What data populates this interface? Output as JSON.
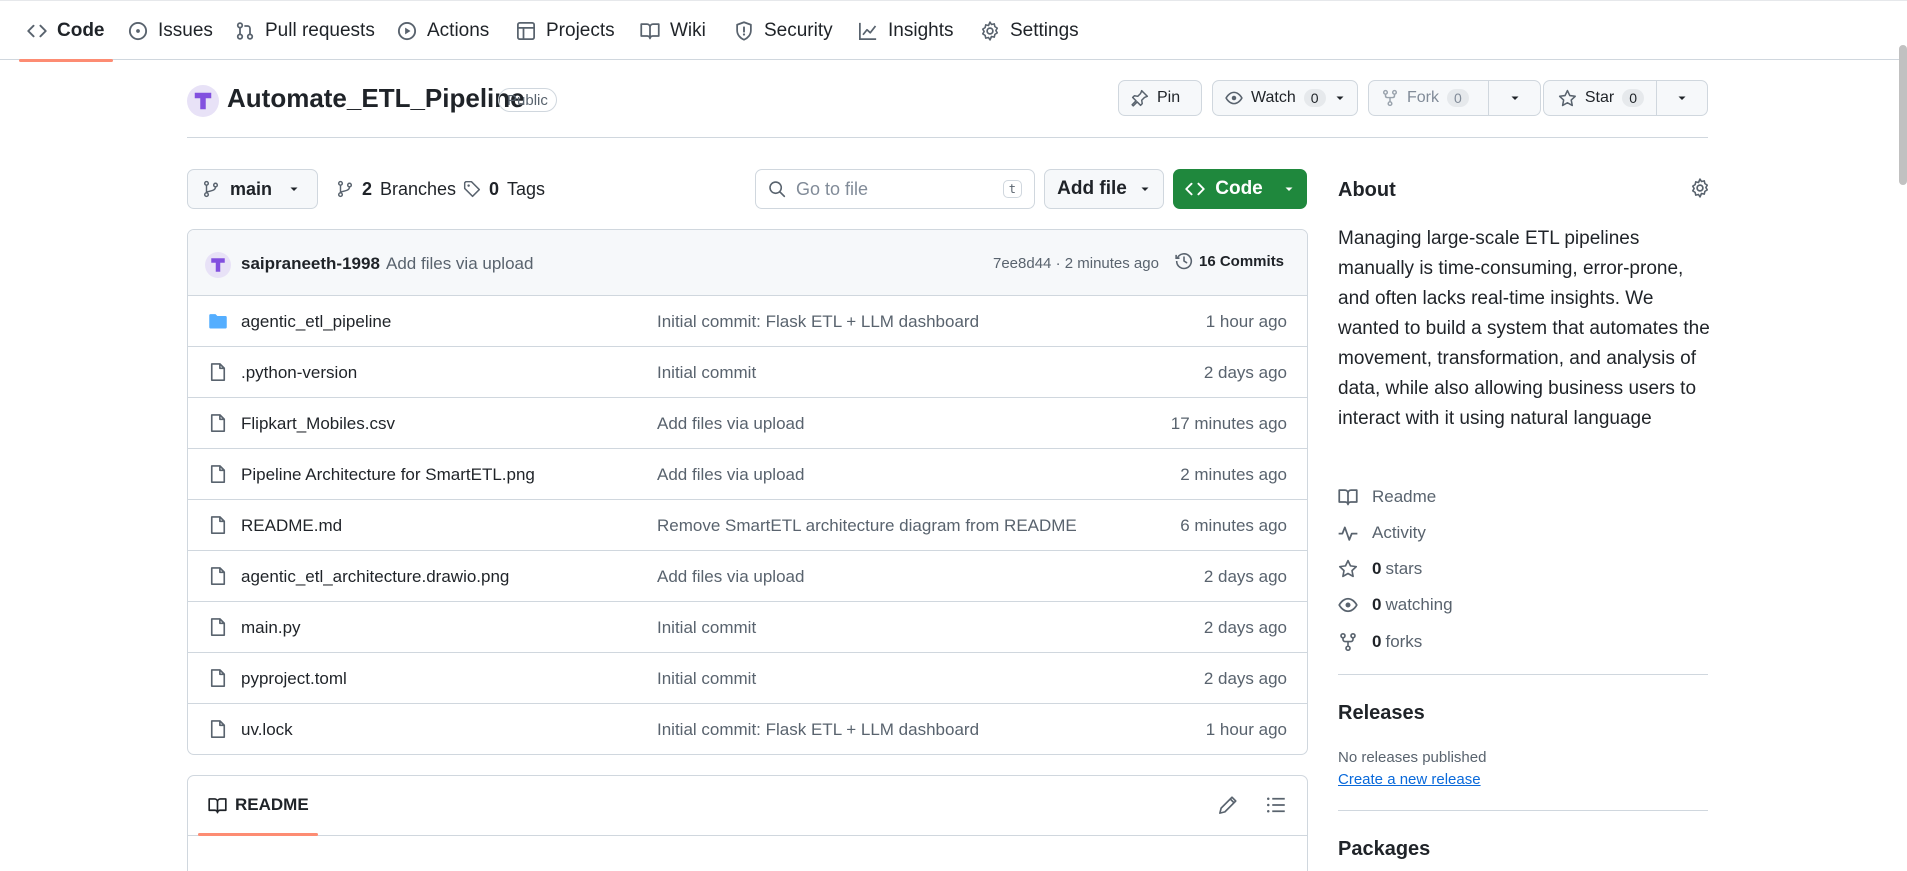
{
  "nav": {
    "tabs": [
      {
        "label": "Code",
        "icon": "code-icon",
        "active": true
      },
      {
        "label": "Issues",
        "icon": "issue-icon"
      },
      {
        "label": "Pull requests",
        "icon": "pull-request-icon"
      },
      {
        "label": "Actions",
        "icon": "play-icon"
      },
      {
        "label": "Projects",
        "icon": "table-icon"
      },
      {
        "label": "Wiki",
        "icon": "book-icon"
      },
      {
        "label": "Security",
        "icon": "shield-icon"
      },
      {
        "label": "Insights",
        "icon": "graph-icon"
      },
      {
        "label": "Settings",
        "icon": "gear-icon"
      }
    ]
  },
  "repo": {
    "name": "Automate_ETL_Pipeline",
    "visibility": "Public",
    "pin_label": "Pin",
    "watch_label": "Watch",
    "watch_count": "0",
    "fork_label": "Fork",
    "fork_count": "0",
    "star_label": "Star",
    "star_count": "0"
  },
  "toolbar": {
    "branch": "main",
    "branches_count": "2",
    "branches_label": "Branches",
    "tags_count": "0",
    "tags_label": "Tags",
    "goto_placeholder": "Go to file",
    "goto_shortcut": "t",
    "add_file_label": "Add file",
    "code_label": "Code"
  },
  "latest_commit": {
    "author": "saipraneeth-1998",
    "message": "Add files via upload",
    "sha_time": "7ee8d44 · 2 minutes ago",
    "commits_label": "16 Commits"
  },
  "files": [
    {
      "name": "agentic_etl_pipeline",
      "type": "folder",
      "message": "Initial commit: Flask ETL + LLM dashboard",
      "time": "1 hour ago"
    },
    {
      "name": ".python-version",
      "type": "file",
      "message": "Initial commit",
      "time": "2 days ago"
    },
    {
      "name": "Flipkart_Mobiles.csv",
      "type": "file",
      "message": "Add files via upload",
      "time": "17 minutes ago"
    },
    {
      "name": "Pipeline Architecture for SmartETL.png",
      "type": "file",
      "message": "Add files via upload",
      "time": "2 minutes ago"
    },
    {
      "name": "README.md",
      "type": "file",
      "message": "Remove SmartETL architecture diagram from README",
      "time": "6 minutes ago"
    },
    {
      "name": "agentic_etl_architecture.drawio.png",
      "type": "file",
      "message": "Add files via upload",
      "time": "2 days ago"
    },
    {
      "name": "main.py",
      "type": "file",
      "message": "Initial commit",
      "time": "2 days ago"
    },
    {
      "name": "pyproject.toml",
      "type": "file",
      "message": "Initial commit",
      "time": "2 days ago"
    },
    {
      "name": "uv.lock",
      "type": "file",
      "message": "Initial commit: Flask ETL + LLM dashboard",
      "time": "1 hour ago"
    }
  ],
  "readme": {
    "tab_label": "README"
  },
  "about": {
    "title": "About",
    "description": "Managing large-scale ETL pipelines manually is time-consuming, error-prone, and often lacks real-time insights. We wanted to build a system that automates the movement, transformation, and analysis of data, while also allowing business users to interact with it using natural language",
    "readme_label": "Readme",
    "activity_label": "Activity",
    "stars_count": "0",
    "stars_label": "stars",
    "watching_count": "0",
    "watching_label": "watching",
    "forks_count": "0",
    "forks_label": "forks"
  },
  "releases": {
    "title": "Releases",
    "empty_text": "No releases published",
    "create_link": "Create a new release"
  },
  "packages": {
    "title": "Packages"
  },
  "colors": {
    "accent_orange": "#fd8c73",
    "code_green": "#1f883d",
    "link_blue": "#0969da",
    "folder_blue": "#54aeff"
  }
}
